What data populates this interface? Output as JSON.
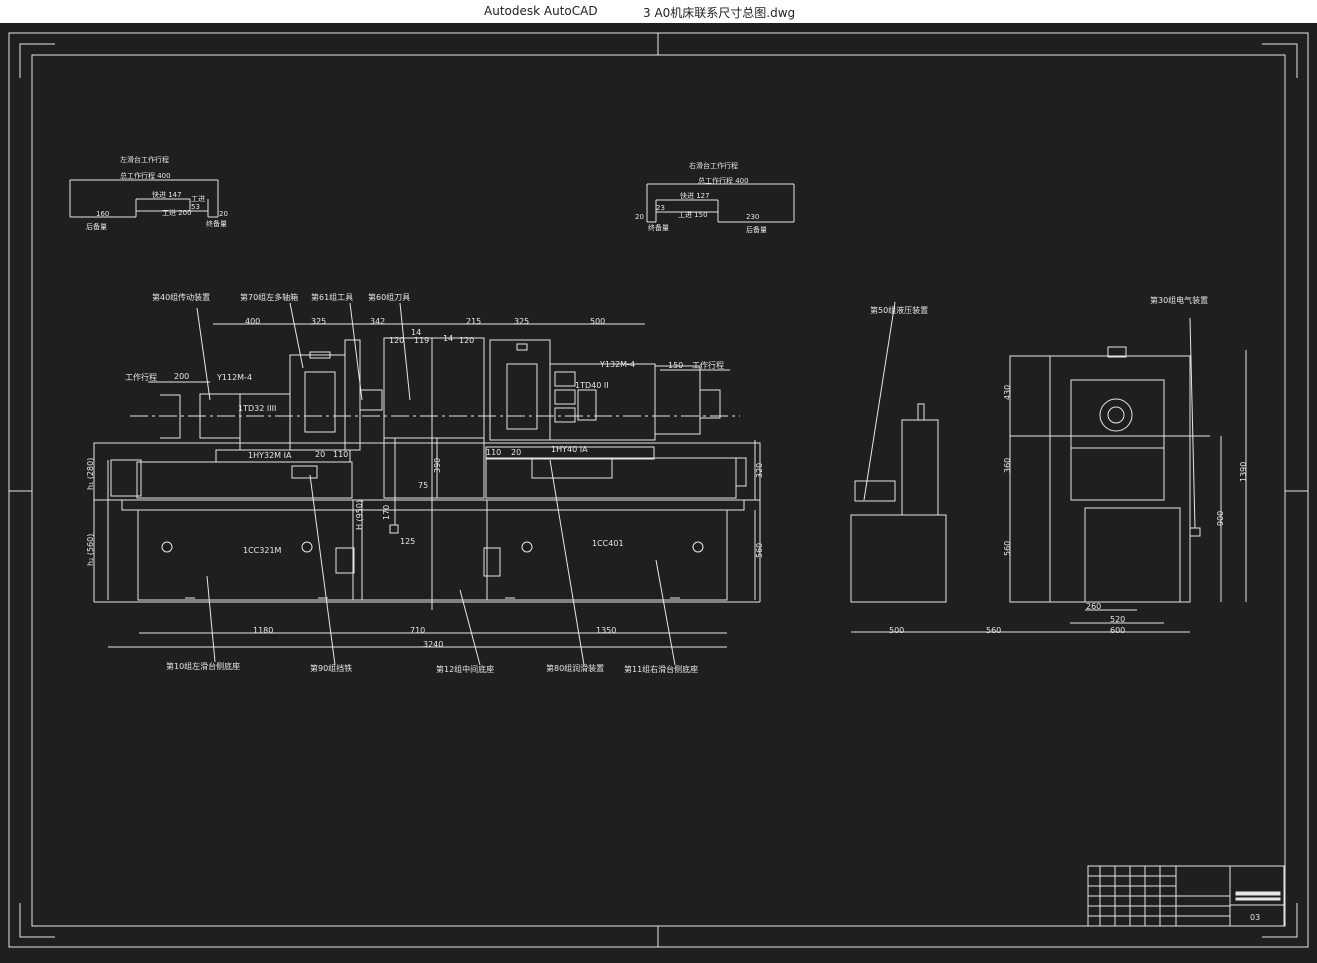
{
  "window": {
    "app_title": "Autodesk AutoCAD",
    "file_name": "3 A0机床联系尺寸总图.dwg"
  },
  "drawing": {
    "background_color": "#1f1f1f",
    "line_color": "#e6e6e6",
    "left_cycle": {
      "title": "左滑台工作行程",
      "total": "总工作行程 400",
      "fast_forward": "快进 147",
      "feed": "工进 200",
      "feed_small": "工进",
      "value_53": "53",
      "value_160": "160",
      "value_20": "20",
      "backup": "后备量",
      "end_label": "终备量"
    },
    "right_cycle": {
      "title": "右滑台工作行程",
      "total": "总工作行程 400",
      "fast_forward": "快进 127",
      "feed": "工进 150",
      "value_23": "23",
      "value_230": "230",
      "value_20": "20",
      "backup": "后备量",
      "end_label": "终备量"
    },
    "labels": {
      "drive_group": "第40组传动装置",
      "left_multi_axle": "第70组左多轴箱",
      "fixture": "第61组工具",
      "tools": "第60组刀具",
      "hydraulic": "第50组液压装置",
      "electrical": "第30组电气装置",
      "left_base": "第10组左滑台侧底座",
      "clamp": "第90组挡铁",
      "middle_base": "第12组中间底座",
      "lube": "第80组润滑装置",
      "right_base": "第11组右滑台侧底座",
      "work_stroke_left": "工作行程",
      "work_stroke_right": "工作行程",
      "motor_left": "Y112M-4",
      "motor_right": "Y132M-4",
      "head_left": "1TD32 IIII",
      "head_right": "1TD40 II",
      "slide_left": "1HY32M IA",
      "slide_right": "1HY40 IA",
      "side_base_left": "1CC321M",
      "side_base_right": "1CC401"
    },
    "dims": {
      "d400": "400",
      "d325a": "325",
      "d342": "342",
      "d14a": "14",
      "d120a": "120",
      "d119": "119",
      "d14b": "14",
      "d215": "215",
      "d120b": "120",
      "d325b": "325",
      "d500": "500",
      "d200": "200",
      "d150": "150",
      "d20a": "20",
      "d110a": "110",
      "d110b": "110",
      "d20b": "20",
      "d390": "390",
      "d75": "75",
      "d170": "170",
      "d125": "125",
      "h280": "h₁ (280)",
      "h560": "h₂ (560)",
      "hh950": "H (950)",
      "d320": "320",
      "d560r": "560",
      "d1180": "1180",
      "d710": "710",
      "d1350": "1350",
      "d3240": "3240",
      "side_500": "500",
      "side_560": "560",
      "end_430": "430",
      "end_360": "360",
      "end_560": "560",
      "end_1390": "1390",
      "end_900": "900",
      "end_260": "260",
      "end_520": "520",
      "end_600": "600"
    },
    "title_block": {
      "sheet_no": "03"
    }
  }
}
